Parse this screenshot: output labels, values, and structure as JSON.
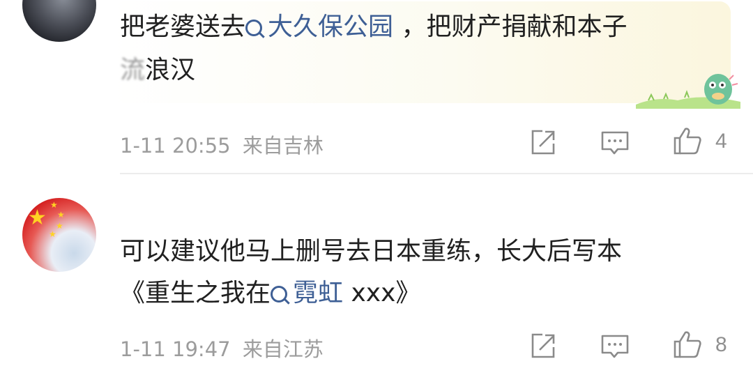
{
  "comments": [
    {
      "text_before_link": "把老婆送去",
      "link_text": "大久保公园",
      "text_after_link": " ，把财产捐献和本子",
      "line2_blurred": "流",
      "line2_rest": "浪汉",
      "timestamp": "1-11 20:55",
      "location": "来自吉林",
      "like_count": "4"
    },
    {
      "line1": "可以建议他马上删号去日本重练，长大后写本",
      "line2_before_link": "《重生之我在",
      "link_text": "霓虹",
      "line2_after_link": " xxx》",
      "timestamp": "1-11 19:47",
      "location": "来自江苏",
      "like_count": "8"
    }
  ],
  "icons": [
    "share-icon",
    "comment-icon",
    "like-icon"
  ],
  "colors": {
    "link": "#3e5f95",
    "meta": "#9c9c9c",
    "text": "#202020"
  }
}
